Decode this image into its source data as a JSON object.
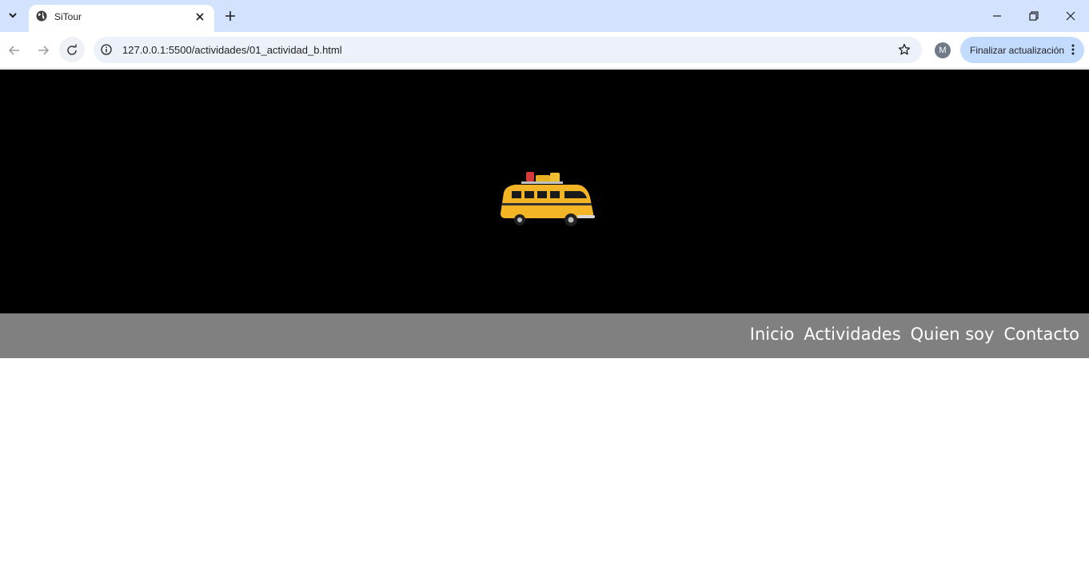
{
  "browser": {
    "tab_title": "SiTour",
    "url": "127.0.0.1:5500/actividades/01_actividad_b.html",
    "profile_initial": "M",
    "update_button_label": "Finalizar actualización"
  },
  "icons": {
    "tab_search": "chevron-down-icon",
    "favicon": "globe-icon",
    "tab_close": "close-icon",
    "new_tab": "plus-icon",
    "back": "arrow-left-icon",
    "forward": "arrow-right-icon",
    "reload": "reload-icon",
    "site_info": "info-icon",
    "bookmark": "star-icon",
    "menu": "kebab-icon",
    "minimize": "minimize-icon",
    "restore": "restore-icon",
    "close_window": "close-icon"
  },
  "hero": {
    "image": "yellow-van-with-luggage",
    "background": "#000000"
  },
  "nav": {
    "items": [
      {
        "label": "Inicio"
      },
      {
        "label": "Actividades"
      },
      {
        "label": "Quien soy"
      },
      {
        "label": "Contacto"
      }
    ],
    "background": "#808080",
    "text_color": "#ffffff"
  }
}
